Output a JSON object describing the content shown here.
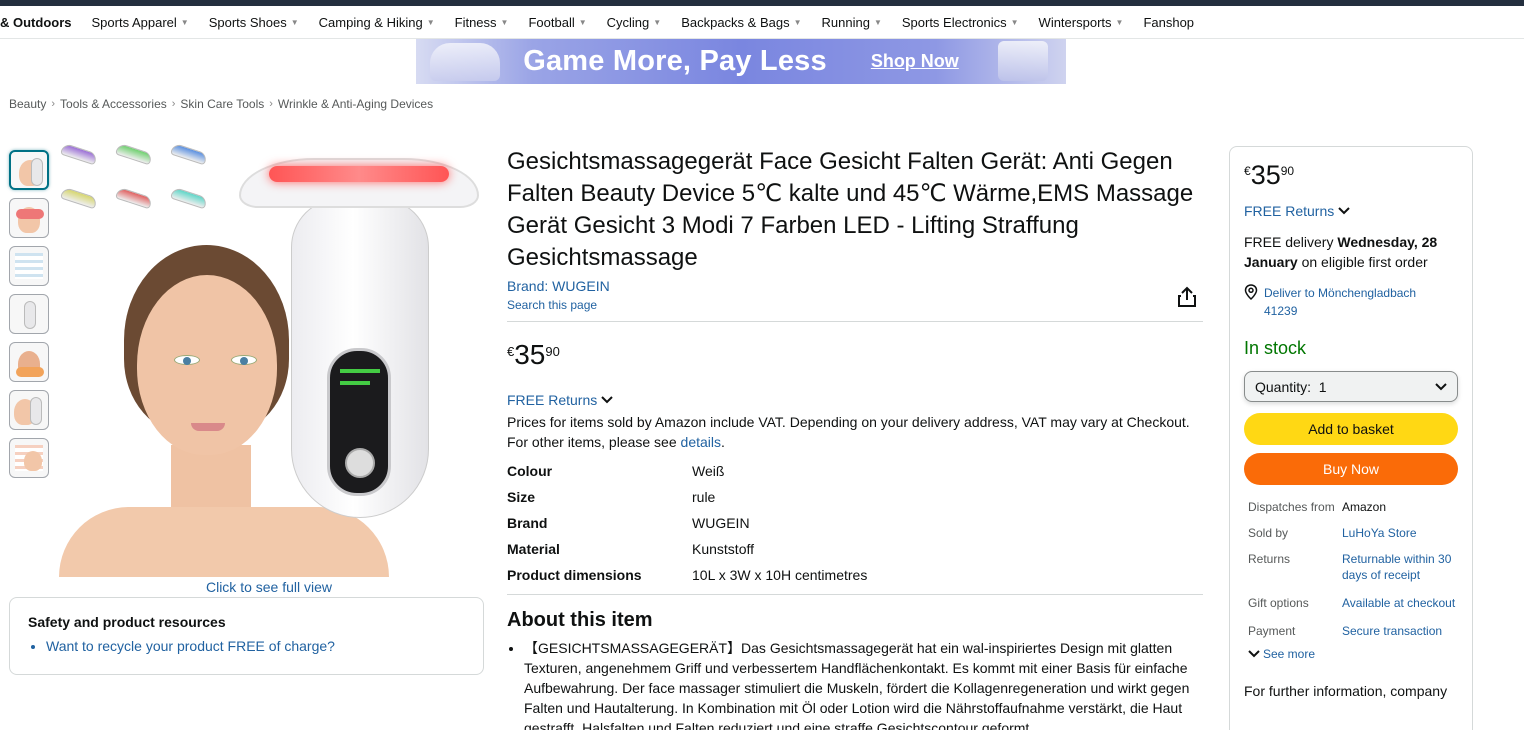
{
  "nav": {
    "items": [
      {
        "label": "& Outdoors",
        "caret": false
      },
      {
        "label": "Sports Apparel",
        "caret": true
      },
      {
        "label": "Sports Shoes",
        "caret": true
      },
      {
        "label": "Camping & Hiking",
        "caret": true
      },
      {
        "label": "Fitness",
        "caret": true
      },
      {
        "label": "Football",
        "caret": true
      },
      {
        "label": "Cycling",
        "caret": true
      },
      {
        "label": "Backpacks & Bags",
        "caret": true
      },
      {
        "label": "Running",
        "caret": true
      },
      {
        "label": "Sports Electronics",
        "caret": true
      },
      {
        "label": "Wintersports",
        "caret": true
      },
      {
        "label": "Fanshop",
        "caret": false
      }
    ]
  },
  "banner": {
    "headline": "Game More, Pay Less",
    "cta": "Shop Now"
  },
  "breadcrumb": [
    "Beauty",
    "Tools & Accessories",
    "Skin Care Tools",
    "Wrinkle & Anti-Aging Devices"
  ],
  "gallery": {
    "caption": "Click to see full view",
    "led_colors": [
      "#9b6fd6",
      "#6fd06f",
      "#5a8fe0",
      "#d6d66f",
      "#e06060",
      "#5fd6c8"
    ]
  },
  "safety": {
    "title": "Safety and product resources",
    "link": "Want to recycle your product FREE of charge?"
  },
  "product": {
    "title": "Gesichtsmassagegerät Face Gesicht Falten Gerät: Anti Gegen Falten Beauty Device 5℃ kalte und 45℃ Wärme,EMS Massage Gerät Gesicht 3 Modi 7 Farben LED - Lifting Straffung Gesichtsmassage",
    "brand_link": "Brand: WUGEIN",
    "search_page": "Search this page",
    "price_currency": "€",
    "price_whole": "35",
    "price_fraction": "90",
    "returns": "FREE Returns",
    "vat_text": "Prices for items sold by Amazon include VAT. Depending on your delivery address, VAT may vary at Checkout. For other items, please see ",
    "vat_link": "details",
    "vat_end": ".",
    "specs": [
      {
        "key": "Colour",
        "value": "Weiß"
      },
      {
        "key": "Size",
        "value": "rule"
      },
      {
        "key": "Brand",
        "value": "WUGEIN"
      },
      {
        "key": "Material",
        "value": "Kunststoff"
      },
      {
        "key": "Product dimensions",
        "value": "10L x 3W x 10H centimetres"
      }
    ],
    "about_heading": "About this item",
    "about_bullet": "【GESICHTSMASSAGEGERÄT】Das Gesichtsmassagegerät hat ein wal-inspiriertes Design mit glatten Texturen, angenehmem Griff und verbessertem Handflächenkontakt. Es kommt mit einer Basis für einfache Aufbewahrung. Der face massager stimuliert die Muskeln, fördert die Kollagenregeneration und wirkt gegen Falten und Hautalterung. In Kombination mit Öl oder Lotion wird die Nährstoffaufnahme verstärkt, die Haut gestrafft, Halsfalten und Falten reduziert und eine straffe Gesichtscontour geformt."
  },
  "buybox": {
    "price_currency": "€",
    "price_whole": "35",
    "price_fraction": "90",
    "returns": "FREE Returns",
    "delivery_prefix": "FREE delivery ",
    "delivery_date": "Wednesday, 28 January",
    "delivery_suffix": " on eligible first order",
    "location": "Deliver to Mönchengladbach 41239",
    "stock": "In stock",
    "quantity": "Quantity:  1",
    "add_to_basket": "Add to basket",
    "buy_now": "Buy Now",
    "info": [
      {
        "key": "Dispatches from",
        "value": "Amazon",
        "link": false
      },
      {
        "key": "Sold by",
        "value": "LuHoYa Store",
        "link": true
      },
      {
        "key": "Returns",
        "value": "Returnable within 30 days of receipt",
        "link": true
      },
      {
        "key": "Gift options",
        "value": "Available at checkout",
        "link": true
      },
      {
        "key": "Payment",
        "value": "Secure transaction",
        "link": true
      }
    ],
    "see_more": "See more",
    "further": "For further information, company"
  }
}
